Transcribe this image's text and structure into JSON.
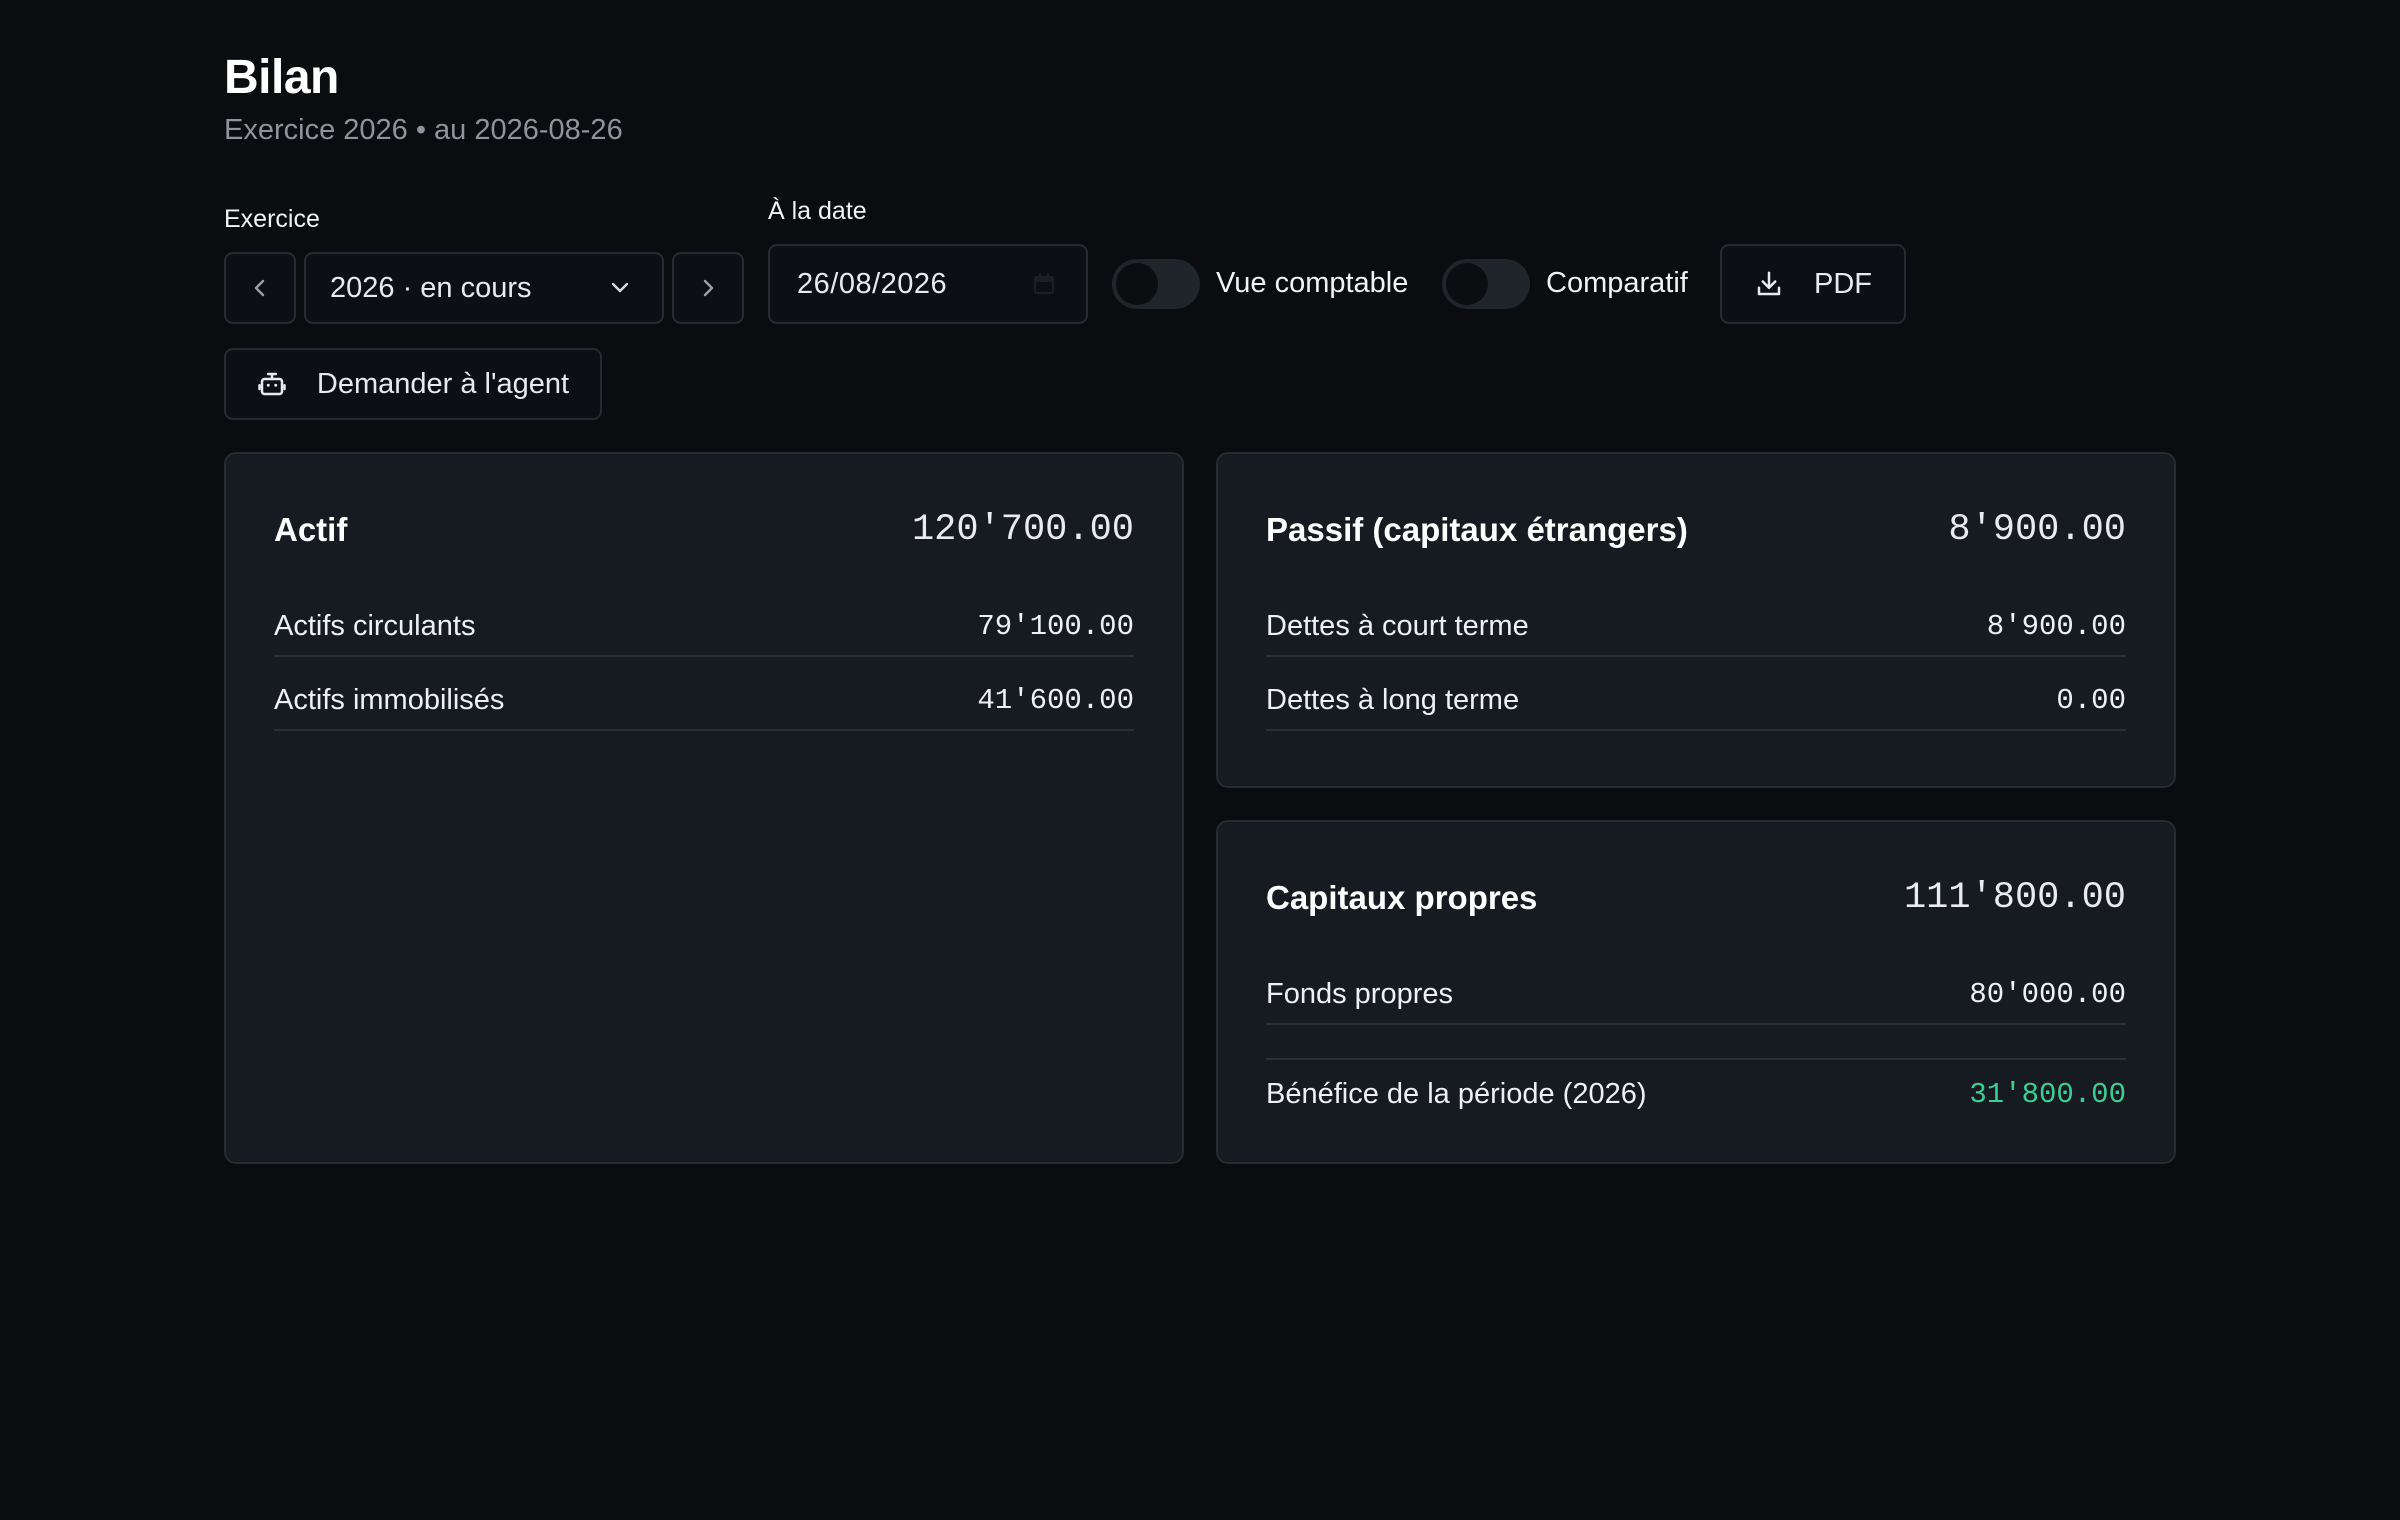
{
  "header": {
    "title": "Bilan",
    "subtitle": "Exercice 2026 • au 2026-08-26"
  },
  "controls": {
    "exercice_label": "Exercice",
    "exercice_value": "2026 · en cours",
    "date_label": "À la date",
    "date_value": "26/08/2026",
    "toggle_vue_comptable": {
      "label": "Vue comptable",
      "on": false
    },
    "toggle_comparatif": {
      "label": "Comparatif",
      "on": false
    },
    "pdf_label": "PDF",
    "agent_label": "Demander à l'agent"
  },
  "actif": {
    "title": "Actif",
    "total": "120'700.00",
    "rows": [
      {
        "label": "Actifs circulants",
        "value": "79'100.00"
      },
      {
        "label": "Actifs immobilisés",
        "value": "41'600.00"
      }
    ]
  },
  "passif": {
    "title": "Passif (capitaux étrangers)",
    "total": "8'900.00",
    "rows": [
      {
        "label": "Dettes à court terme",
        "value": "8'900.00"
      },
      {
        "label": "Dettes à long terme",
        "value": "0.00"
      }
    ]
  },
  "capitaux": {
    "title": "Capitaux propres",
    "total": "111'800.00",
    "rows": [
      {
        "label": "Fonds propres",
        "value": "80'000.00"
      },
      {
        "label": "Bénéfice de la période (2026)",
        "value": "31'800.00"
      }
    ]
  },
  "colors": {
    "background": "#0a0c10",
    "card": "#161a21",
    "positive": "#3ccf94"
  }
}
